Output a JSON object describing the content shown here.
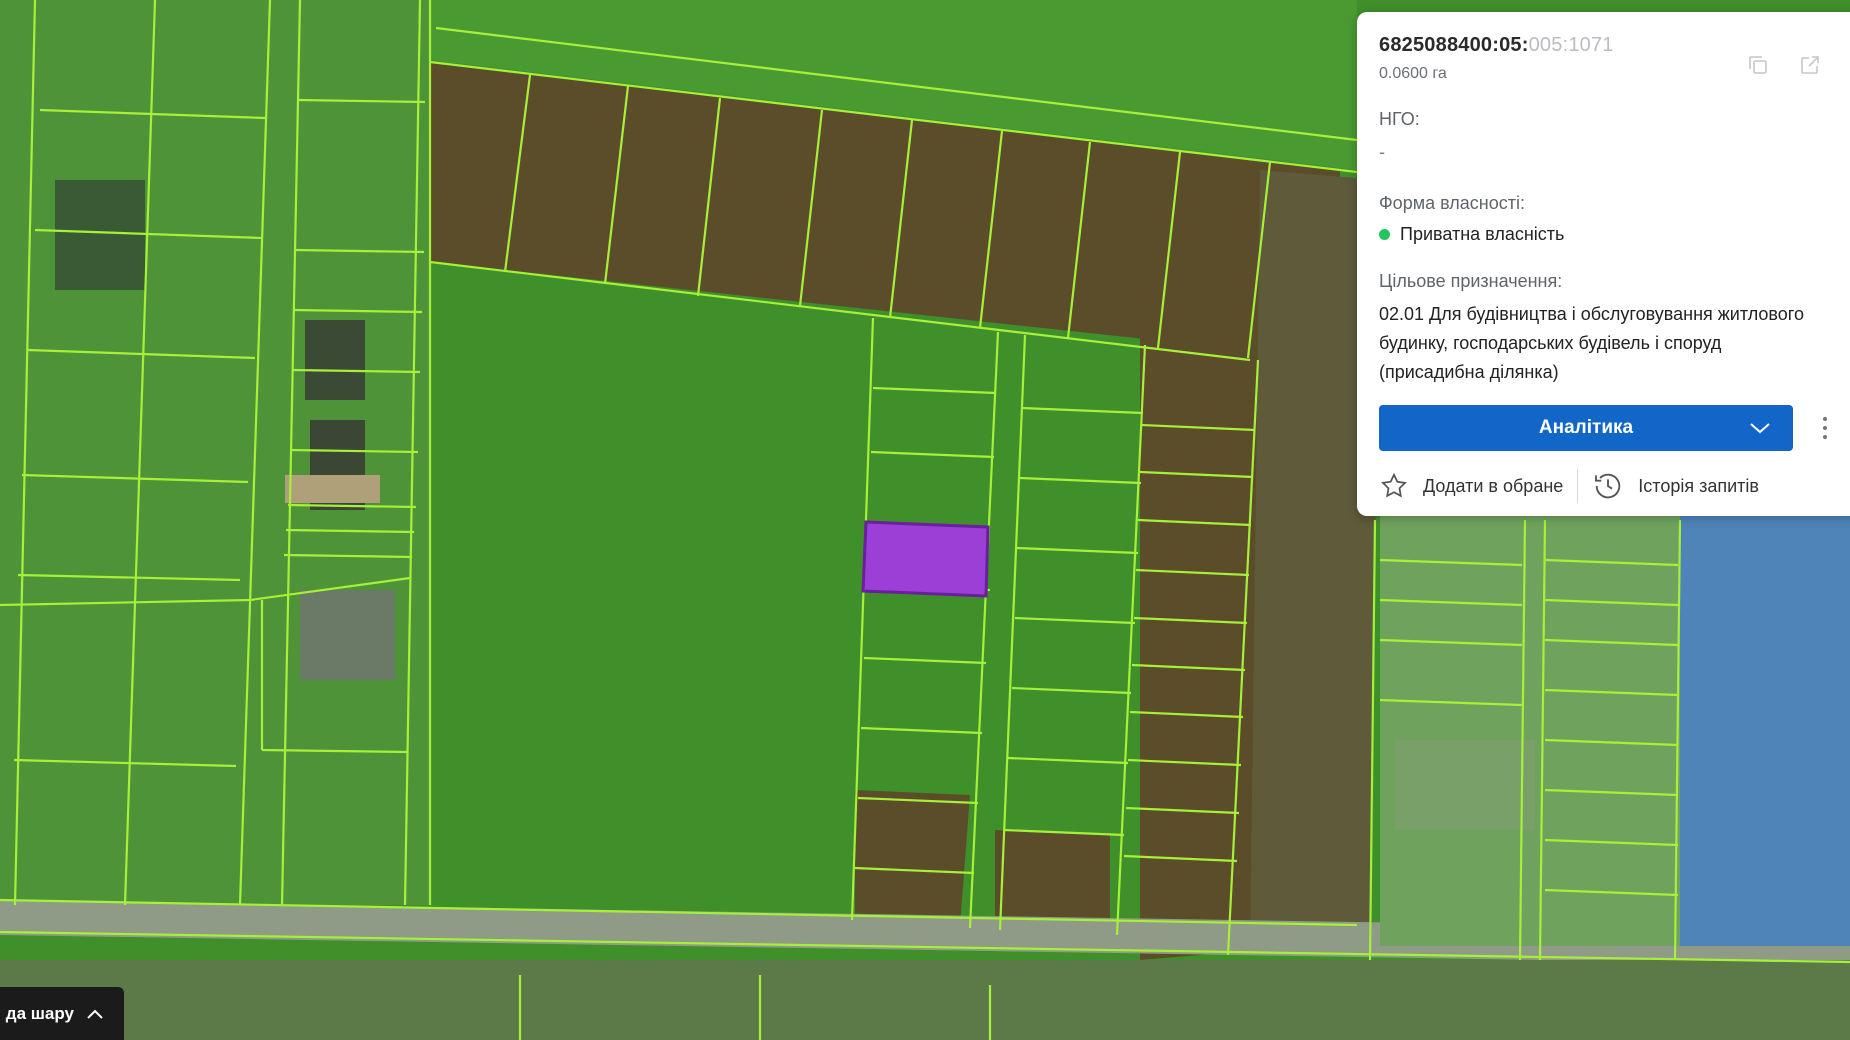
{
  "card": {
    "cadastral_main": "6825088400:05:",
    "cadastral_rest": "005:1071",
    "area": "0.0600 га",
    "ngo_label": "НГО:",
    "ngo_value": "-",
    "ownership_label": "Форма власності:",
    "ownership_value": "Приватна власність",
    "purpose_label": "Цільове призначення:",
    "purpose_value": "02.01 Для будівництва і обслуговування житлового будинку, господарських будівель і споруд (присадибна ділянка)",
    "analytics_button": "Аналітика",
    "favorite_label": "Додати в обране",
    "history_label": "Історія запитів",
    "status_color": "#22c55e",
    "accent_color": "#1166c7"
  },
  "legend_button": "да шару",
  "colors": {
    "parcel_border": "#a6f03a",
    "selected_parcel": "#9b3fd6",
    "field": "#3f8f2a",
    "plowed": "#5a4a26"
  }
}
